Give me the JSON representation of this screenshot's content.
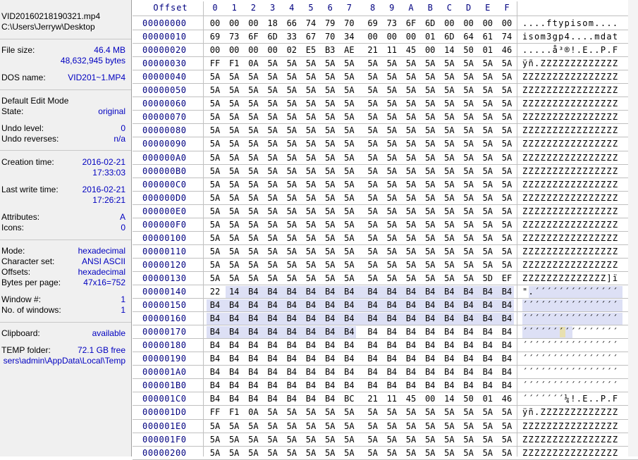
{
  "file": {
    "name": "VID20160218190321.mp4",
    "path": "C:\\Users\\Jerryw\\Desktop"
  },
  "info": {
    "file_size_label": "File size:",
    "file_size_mb": "46.4 MB",
    "file_size_bytes": "48,632,945 bytes",
    "dos_name_label": "DOS name:",
    "dos_name": "VID201~1.MP4",
    "edit_mode_label": "Default Edit Mode",
    "state_label": "State:",
    "state": "original",
    "undo_level_label": "Undo level:",
    "undo_level": "0",
    "undo_reverses_label": "Undo reverses:",
    "undo_reverses": "n/a",
    "creation_label": "Creation time:",
    "creation_date": "2016-02-21",
    "creation_time": "17:33:03",
    "lastwrite_label": "Last write time:",
    "lastwrite_date": "2016-02-21",
    "lastwrite_time": "17:26:21",
    "attributes_label": "Attributes:",
    "attributes": "A",
    "icons_label": "Icons:",
    "icons": "0",
    "mode_label": "Mode:",
    "mode": "hexadecimal",
    "charset_label": "Character set:",
    "charset": "ANSI ASCII",
    "offsets_label": "Offsets:",
    "offsets": "hexadecimal",
    "bpp_label": "Bytes per page:",
    "bpp": "47x16=752",
    "window_label": "Window #:",
    "window": "1",
    "nwindows_label": "No. of windows:",
    "nwindows": "1",
    "clipboard_label": "Clipboard:",
    "clipboard": "available",
    "temp_label": "TEMP folder:",
    "temp_free": "72.1 GB free",
    "temp_path": "sers\\admin\\AppData\\Local\\Temp"
  },
  "hex": {
    "offset_header": "Offset",
    "columns": [
      "0",
      "1",
      "2",
      "3",
      "4",
      "5",
      "6",
      "7",
      "8",
      "9",
      "A",
      "B",
      "C",
      "D",
      "E",
      "F"
    ],
    "rows": [
      {
        "offset": "00000000",
        "bytes": [
          "00",
          "00",
          "00",
          "18",
          "66",
          "74",
          "79",
          "70",
          "69",
          "73",
          "6F",
          "6D",
          "00",
          "00",
          "00",
          "00"
        ],
        "ascii": "....ftypisom...."
      },
      {
        "offset": "00000010",
        "bytes": [
          "69",
          "73",
          "6F",
          "6D",
          "33",
          "67",
          "70",
          "34",
          "00",
          "00",
          "00",
          "01",
          "6D",
          "64",
          "61",
          "74"
        ],
        "ascii": "isom3gp4....mdat"
      },
      {
        "offset": "00000020",
        "bytes": [
          "00",
          "00",
          "00",
          "00",
          "02",
          "E5",
          "B3",
          "AE",
          "21",
          "11",
          "45",
          "00",
          "14",
          "50",
          "01",
          "46"
        ],
        "ascii": ".....å³®!.E..P.F"
      },
      {
        "offset": "00000030",
        "bytes": [
          "FF",
          "F1",
          "0A",
          "5A",
          "5A",
          "5A",
          "5A",
          "5A",
          "5A",
          "5A",
          "5A",
          "5A",
          "5A",
          "5A",
          "5A",
          "5A"
        ],
        "ascii": "ÿñ.ZZZZZZZZZZZZZ"
      },
      {
        "offset": "00000040",
        "bytes": [
          "5A",
          "5A",
          "5A",
          "5A",
          "5A",
          "5A",
          "5A",
          "5A",
          "5A",
          "5A",
          "5A",
          "5A",
          "5A",
          "5A",
          "5A",
          "5A"
        ],
        "ascii": "ZZZZZZZZZZZZZZZZ"
      },
      {
        "offset": "00000050",
        "bytes": [
          "5A",
          "5A",
          "5A",
          "5A",
          "5A",
          "5A",
          "5A",
          "5A",
          "5A",
          "5A",
          "5A",
          "5A",
          "5A",
          "5A",
          "5A",
          "5A"
        ],
        "ascii": "ZZZZZZZZZZZZZZZZ"
      },
      {
        "offset": "00000060",
        "bytes": [
          "5A",
          "5A",
          "5A",
          "5A",
          "5A",
          "5A",
          "5A",
          "5A",
          "5A",
          "5A",
          "5A",
          "5A",
          "5A",
          "5A",
          "5A",
          "5A"
        ],
        "ascii": "ZZZZZZZZZZZZZZZZ"
      },
      {
        "offset": "00000070",
        "bytes": [
          "5A",
          "5A",
          "5A",
          "5A",
          "5A",
          "5A",
          "5A",
          "5A",
          "5A",
          "5A",
          "5A",
          "5A",
          "5A",
          "5A",
          "5A",
          "5A"
        ],
        "ascii": "ZZZZZZZZZZZZZZZZ"
      },
      {
        "offset": "00000080",
        "bytes": [
          "5A",
          "5A",
          "5A",
          "5A",
          "5A",
          "5A",
          "5A",
          "5A",
          "5A",
          "5A",
          "5A",
          "5A",
          "5A",
          "5A",
          "5A",
          "5A"
        ],
        "ascii": "ZZZZZZZZZZZZZZZZ"
      },
      {
        "offset": "00000090",
        "bytes": [
          "5A",
          "5A",
          "5A",
          "5A",
          "5A",
          "5A",
          "5A",
          "5A",
          "5A",
          "5A",
          "5A",
          "5A",
          "5A",
          "5A",
          "5A",
          "5A"
        ],
        "ascii": "ZZZZZZZZZZZZZZZZ"
      },
      {
        "offset": "000000A0",
        "bytes": [
          "5A",
          "5A",
          "5A",
          "5A",
          "5A",
          "5A",
          "5A",
          "5A",
          "5A",
          "5A",
          "5A",
          "5A",
          "5A",
          "5A",
          "5A",
          "5A"
        ],
        "ascii": "ZZZZZZZZZZZZZZZZ"
      },
      {
        "offset": "000000B0",
        "bytes": [
          "5A",
          "5A",
          "5A",
          "5A",
          "5A",
          "5A",
          "5A",
          "5A",
          "5A",
          "5A",
          "5A",
          "5A",
          "5A",
          "5A",
          "5A",
          "5A"
        ],
        "ascii": "ZZZZZZZZZZZZZZZZ"
      },
      {
        "offset": "000000C0",
        "bytes": [
          "5A",
          "5A",
          "5A",
          "5A",
          "5A",
          "5A",
          "5A",
          "5A",
          "5A",
          "5A",
          "5A",
          "5A",
          "5A",
          "5A",
          "5A",
          "5A"
        ],
        "ascii": "ZZZZZZZZZZZZZZZZ"
      },
      {
        "offset": "000000D0",
        "bytes": [
          "5A",
          "5A",
          "5A",
          "5A",
          "5A",
          "5A",
          "5A",
          "5A",
          "5A",
          "5A",
          "5A",
          "5A",
          "5A",
          "5A",
          "5A",
          "5A"
        ],
        "ascii": "ZZZZZZZZZZZZZZZZ"
      },
      {
        "offset": "000000E0",
        "bytes": [
          "5A",
          "5A",
          "5A",
          "5A",
          "5A",
          "5A",
          "5A",
          "5A",
          "5A",
          "5A",
          "5A",
          "5A",
          "5A",
          "5A",
          "5A",
          "5A"
        ],
        "ascii": "ZZZZZZZZZZZZZZZZ"
      },
      {
        "offset": "000000F0",
        "bytes": [
          "5A",
          "5A",
          "5A",
          "5A",
          "5A",
          "5A",
          "5A",
          "5A",
          "5A",
          "5A",
          "5A",
          "5A",
          "5A",
          "5A",
          "5A",
          "5A"
        ],
        "ascii": "ZZZZZZZZZZZZZZZZ"
      },
      {
        "offset": "00000100",
        "bytes": [
          "5A",
          "5A",
          "5A",
          "5A",
          "5A",
          "5A",
          "5A",
          "5A",
          "5A",
          "5A",
          "5A",
          "5A",
          "5A",
          "5A",
          "5A",
          "5A"
        ],
        "ascii": "ZZZZZZZZZZZZZZZZ"
      },
      {
        "offset": "00000110",
        "bytes": [
          "5A",
          "5A",
          "5A",
          "5A",
          "5A",
          "5A",
          "5A",
          "5A",
          "5A",
          "5A",
          "5A",
          "5A",
          "5A",
          "5A",
          "5A",
          "5A"
        ],
        "ascii": "ZZZZZZZZZZZZZZZZ"
      },
      {
        "offset": "00000120",
        "bytes": [
          "5A",
          "5A",
          "5A",
          "5A",
          "5A",
          "5A",
          "5A",
          "5A",
          "5A",
          "5A",
          "5A",
          "5A",
          "5A",
          "5A",
          "5A",
          "5A"
        ],
        "ascii": "ZZZZZZZZZZZZZZZZ"
      },
      {
        "offset": "00000130",
        "bytes": [
          "5A",
          "5A",
          "5A",
          "5A",
          "5A",
          "5A",
          "5A",
          "5A",
          "5A",
          "5A",
          "5A",
          "5A",
          "5A",
          "5A",
          "5D",
          "EF"
        ],
        "ascii": "ZZZZZZZZZZZZZZ]ï"
      },
      {
        "offset": "00000140",
        "bytes": [
          "22",
          "14",
          "B4",
          "B4",
          "B4",
          "B4",
          "B4",
          "B4",
          "B4",
          "B4",
          "B4",
          "B4",
          "B4",
          "B4",
          "B4",
          "B4"
        ],
        "ascii": "\".´´´´´´´´´´´´´´"
      },
      {
        "offset": "00000150",
        "bytes": [
          "B4",
          "B4",
          "B4",
          "B4",
          "B4",
          "B4",
          "B4",
          "B4",
          "B4",
          "B4",
          "B4",
          "B4",
          "B4",
          "B4",
          "B4",
          "B4"
        ],
        "ascii": "´´´´´´´´´´´´´´´´"
      },
      {
        "offset": "00000160",
        "bytes": [
          "B4",
          "B4",
          "B4",
          "B4",
          "B4",
          "B4",
          "B4",
          "B4",
          "B4",
          "B4",
          "B4",
          "B4",
          "B4",
          "B4",
          "B4",
          "B4"
        ],
        "ascii": "´´´´´´´´´´´´´´´´"
      },
      {
        "offset": "00000170",
        "bytes": [
          "B4",
          "B4",
          "B4",
          "B4",
          "B4",
          "B4",
          "B4",
          "B4",
          "B4",
          "B4",
          "B4",
          "B4",
          "B4",
          "B4",
          "B4",
          "B4"
        ],
        "ascii": "´´´´´´´´´´´´´´´´"
      },
      {
        "offset": "00000180",
        "bytes": [
          "B4",
          "B4",
          "B4",
          "B4",
          "B4",
          "B4",
          "B4",
          "B4",
          "B4",
          "B4",
          "B4",
          "B4",
          "B4",
          "B4",
          "B4",
          "B4"
        ],
        "ascii": "´´´´´´´´´´´´´´´´"
      },
      {
        "offset": "00000190",
        "bytes": [
          "B4",
          "B4",
          "B4",
          "B4",
          "B4",
          "B4",
          "B4",
          "B4",
          "B4",
          "B4",
          "B4",
          "B4",
          "B4",
          "B4",
          "B4",
          "B4"
        ],
        "ascii": "´´´´´´´´´´´´´´´´"
      },
      {
        "offset": "000001A0",
        "bytes": [
          "B4",
          "B4",
          "B4",
          "B4",
          "B4",
          "B4",
          "B4",
          "B4",
          "B4",
          "B4",
          "B4",
          "B4",
          "B4",
          "B4",
          "B4",
          "B4"
        ],
        "ascii": "´´´´´´´´´´´´´´´´"
      },
      {
        "offset": "000001B0",
        "bytes": [
          "B4",
          "B4",
          "B4",
          "B4",
          "B4",
          "B4",
          "B4",
          "B4",
          "B4",
          "B4",
          "B4",
          "B4",
          "B4",
          "B4",
          "B4",
          "B4"
        ],
        "ascii": "´´´´´´´´´´´´´´´´"
      },
      {
        "offset": "000001C0",
        "bytes": [
          "B4",
          "B4",
          "B4",
          "B4",
          "B4",
          "B4",
          "B4",
          "BC",
          "21",
          "11",
          "45",
          "00",
          "14",
          "50",
          "01",
          "46"
        ],
        "ascii": "´´´´´´´¼!.E..P.F"
      },
      {
        "offset": "000001D0",
        "bytes": [
          "FF",
          "F1",
          "0A",
          "5A",
          "5A",
          "5A",
          "5A",
          "5A",
          "5A",
          "5A",
          "5A",
          "5A",
          "5A",
          "5A",
          "5A",
          "5A"
        ],
        "ascii": "ÿñ.ZZZZZZZZZZZZZ"
      },
      {
        "offset": "000001E0",
        "bytes": [
          "5A",
          "5A",
          "5A",
          "5A",
          "5A",
          "5A",
          "5A",
          "5A",
          "5A",
          "5A",
          "5A",
          "5A",
          "5A",
          "5A",
          "5A",
          "5A"
        ],
        "ascii": "ZZZZZZZZZZZZZZZZ"
      },
      {
        "offset": "000001F0",
        "bytes": [
          "5A",
          "5A",
          "5A",
          "5A",
          "5A",
          "5A",
          "5A",
          "5A",
          "5A",
          "5A",
          "5A",
          "5A",
          "5A",
          "5A",
          "5A",
          "5A"
        ],
        "ascii": "ZZZZZZZZZZZZZZZZ"
      },
      {
        "offset": "00000200",
        "bytes": [
          "5A",
          "5A",
          "5A",
          "5A",
          "5A",
          "5A",
          "5A",
          "5A",
          "5A",
          "5A",
          "5A",
          "5A",
          "5A",
          "5A",
          "5A",
          "5A"
        ],
        "ascii": "ZZZZZZZZZZZZZZZZ"
      }
    ],
    "selection": {
      "start_offset": "00000141",
      "end_offset": "00000177"
    },
    "cursor_offset": "00000176"
  }
}
